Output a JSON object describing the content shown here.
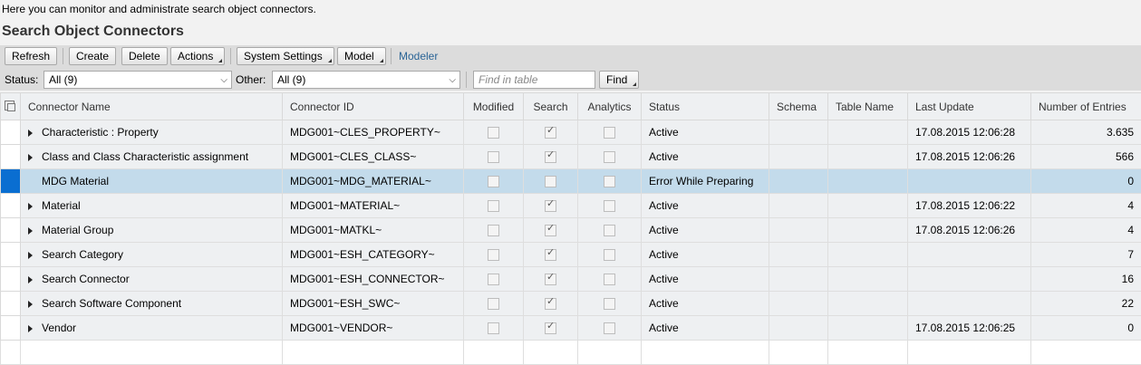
{
  "intro_text": "Here you can monitor and administrate search object connectors.",
  "page_title": "Search Object Connectors",
  "toolbar": {
    "refresh": "Refresh",
    "create": "Create",
    "delete": "Delete",
    "actions": "Actions",
    "system_settings": "System Settings",
    "model": "Model",
    "modeler": "Modeler"
  },
  "filter": {
    "status_label": "Status:",
    "status_value": "All (9)",
    "other_label": "Other:",
    "other_value": "All (9)",
    "find_placeholder": "Find in table",
    "find_button": "Find"
  },
  "table": {
    "columns": [
      "Connector Name",
      "Connector ID",
      "Modified",
      "Search",
      "Analytics",
      "Status",
      "Schema",
      "Table Name",
      "Last Update",
      "Number of Entries"
    ],
    "rows": [
      {
        "name": "Characteristic : Property",
        "id": "MDG001~CLES_PROPERTY~",
        "modified": false,
        "search": true,
        "analytics": false,
        "status": "Active",
        "schema": "",
        "table_name": "",
        "last_update": "17.08.2015 12:06:28",
        "entries": "3.635",
        "expandable": true
      },
      {
        "name": "Class and Class Characteristic assignment",
        "id": "MDG001~CLES_CLASS~",
        "modified": false,
        "search": true,
        "analytics": false,
        "status": "Active",
        "schema": "",
        "table_name": "",
        "last_update": "17.08.2015 12:06:26",
        "entries": "566",
        "expandable": true
      },
      {
        "name": "MDG Material",
        "id": "MDG001~MDG_MATERIAL~",
        "modified": false,
        "search": false,
        "analytics": false,
        "status": "Error While Preparing",
        "schema": "",
        "table_name": "",
        "last_update": "",
        "entries": "0",
        "expandable": false
      },
      {
        "name": "Material",
        "id": "MDG001~MATERIAL~",
        "modified": false,
        "search": true,
        "analytics": false,
        "status": "Active",
        "schema": "",
        "table_name": "",
        "last_update": "17.08.2015 12:06:22",
        "entries": "4",
        "expandable": true
      },
      {
        "name": "Material Group",
        "id": "MDG001~MATKL~",
        "modified": false,
        "search": true,
        "analytics": false,
        "status": "Active",
        "schema": "",
        "table_name": "",
        "last_update": "17.08.2015 12:06:26",
        "entries": "4",
        "expandable": true
      },
      {
        "name": "Search Category",
        "id": "MDG001~ESH_CATEGORY~",
        "modified": false,
        "search": true,
        "analytics": false,
        "status": "Active",
        "schema": "",
        "table_name": "",
        "last_update": "",
        "entries": "7",
        "expandable": true
      },
      {
        "name": "Search Connector",
        "id": "MDG001~ESH_CONNECTOR~",
        "modified": false,
        "search": true,
        "analytics": false,
        "status": "Active",
        "schema": "",
        "table_name": "",
        "last_update": "",
        "entries": "16",
        "expandable": true
      },
      {
        "name": "Search Software Component",
        "id": "MDG001~ESH_SWC~",
        "modified": false,
        "search": true,
        "analytics": false,
        "status": "Active",
        "schema": "",
        "table_name": "",
        "last_update": "",
        "entries": "22",
        "expandable": true
      },
      {
        "name": "Vendor",
        "id": "MDG001~VENDOR~",
        "modified": false,
        "search": true,
        "analytics": false,
        "status": "Active",
        "schema": "",
        "table_name": "",
        "last_update": "17.08.2015 12:06:25",
        "entries": "0",
        "expandable": true
      }
    ]
  }
}
